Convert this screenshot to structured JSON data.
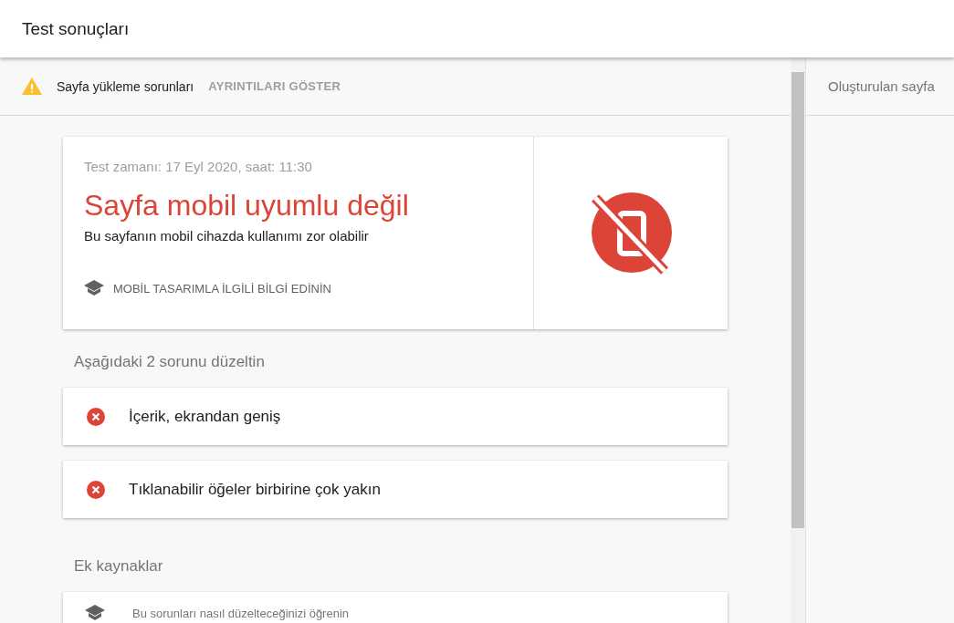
{
  "header": {
    "title": "Test sonuçları"
  },
  "warning_bar": {
    "text": "Sayfa yükleme sorunları",
    "action": "AYRINTILARI GÖSTER"
  },
  "result_card": {
    "test_time": "Test zamanı: 17 Eyl 2020, saat: 11:30",
    "headline": "Sayfa mobil uyumlu değil",
    "subtitle": "Bu sayfanın mobil cihazda kullanımı zor olabilir",
    "learn_link": "MOBİL TASARIMLA İLGİLİ BİLGİ EDİNİN"
  },
  "issues_heading": "Aşağıdaki 2 sorunu düzeltin",
  "issues": [
    {
      "label": "İçerik, ekrandan geniş"
    },
    {
      "label": "Tıklanabilir öğeler birbirine çok yakın"
    }
  ],
  "resources_heading": "Ek kaynaklar",
  "resources": [
    {
      "label": "Bu sorunları nasıl düzelteceğinizi öğrenin"
    }
  ],
  "right_panel": {
    "title": "Oluşturulan sayfa"
  }
}
